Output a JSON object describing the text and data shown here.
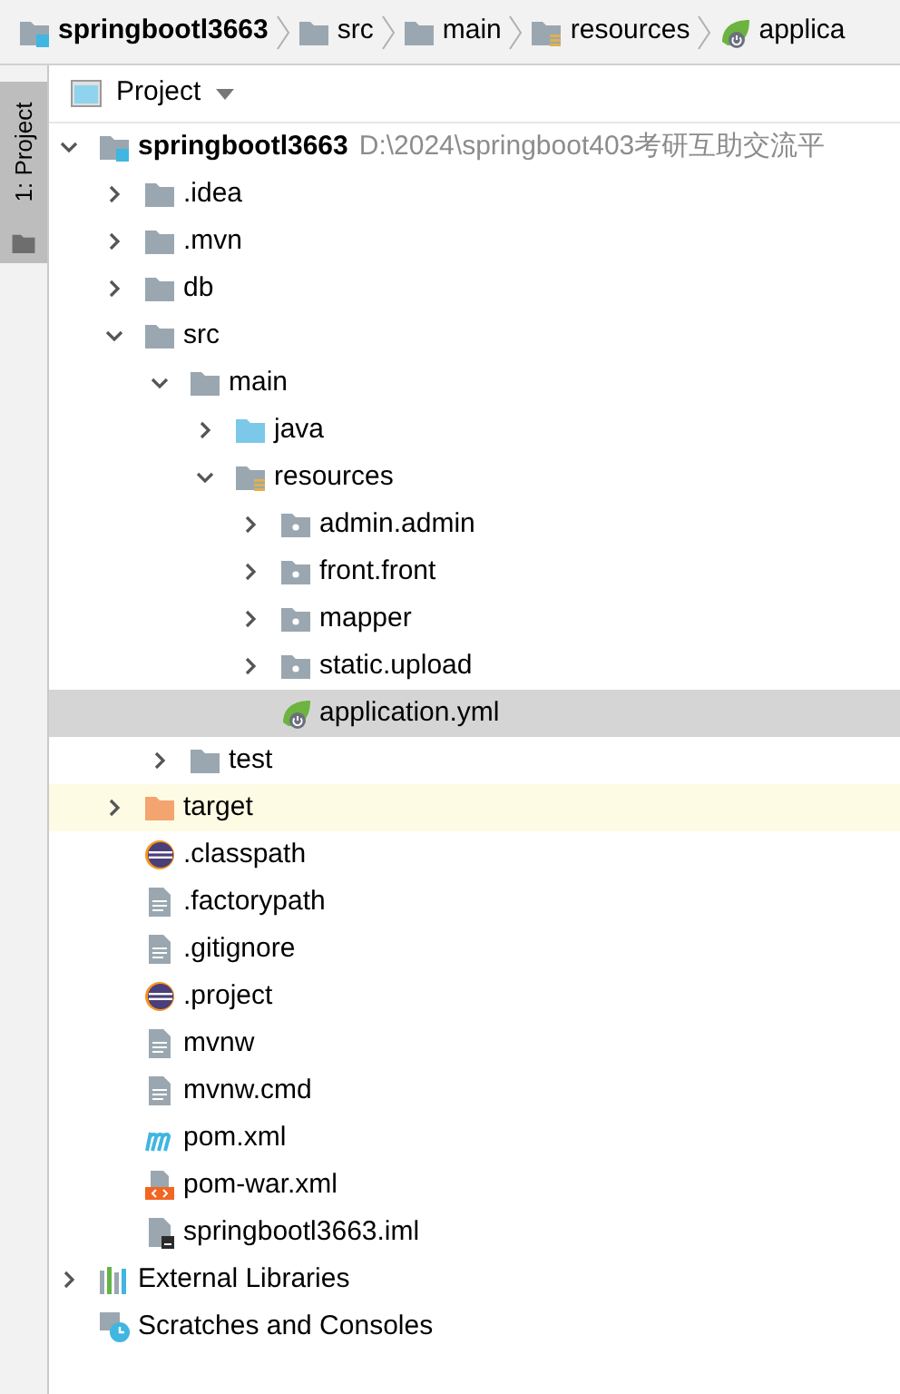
{
  "breadcrumbs": [
    {
      "label": "springbootl3663",
      "kind": "module",
      "bold": true
    },
    {
      "label": "src",
      "kind": "folder",
      "bold": false
    },
    {
      "label": "main",
      "kind": "folder",
      "bold": false
    },
    {
      "label": "resources",
      "kind": "resources",
      "bold": false
    },
    {
      "label": "applica",
      "kind": "spring",
      "bold": false
    }
  ],
  "side_tab": {
    "label": "1: Project",
    "selected": true
  },
  "panel": {
    "title": "Project"
  },
  "tree": [
    {
      "name": "springbootl3663",
      "path": "D:\\2024\\springboot403考研互助交流平",
      "kind": "module",
      "expanded": true,
      "children": [
        {
          "name": ".idea",
          "kind": "folder",
          "expanded": false
        },
        {
          "name": ".mvn",
          "kind": "folder",
          "expanded": false
        },
        {
          "name": "db",
          "kind": "folder",
          "expanded": false
        },
        {
          "name": "src",
          "kind": "folder",
          "expanded": true,
          "children": [
            {
              "name": "main",
              "kind": "folder",
              "expanded": true,
              "children": [
                {
                  "name": "java",
                  "kind": "source",
                  "expanded": false
                },
                {
                  "name": "resources",
                  "kind": "resources",
                  "expanded": true,
                  "children": [
                    {
                      "name": "admin.admin",
                      "kind": "package",
                      "expanded": false
                    },
                    {
                      "name": "front.front",
                      "kind": "package",
                      "expanded": false
                    },
                    {
                      "name": "mapper",
                      "kind": "package",
                      "expanded": false
                    },
                    {
                      "name": "static.upload",
                      "kind": "package",
                      "expanded": false
                    },
                    {
                      "name": "application.yml",
                      "kind": "spring",
                      "selected": true
                    }
                  ]
                }
              ]
            },
            {
              "name": "test",
              "kind": "folder",
              "expanded": false
            }
          ]
        },
        {
          "name": "target",
          "kind": "excluded",
          "expanded": false,
          "highlighted": true
        },
        {
          "name": ".classpath",
          "kind": "eclipse"
        },
        {
          "name": ".factorypath",
          "kind": "text"
        },
        {
          "name": ".gitignore",
          "kind": "text"
        },
        {
          "name": ".project",
          "kind": "eclipse"
        },
        {
          "name": "mvnw",
          "kind": "text"
        },
        {
          "name": "mvnw.cmd",
          "kind": "text"
        },
        {
          "name": "pom.xml",
          "kind": "maven"
        },
        {
          "name": "pom-war.xml",
          "kind": "xml"
        },
        {
          "name": "springbootl3663.iml",
          "kind": "iml"
        }
      ]
    },
    {
      "name": "External Libraries",
      "kind": "libraries",
      "expanded": false
    },
    {
      "name": "Scratches and Consoles",
      "kind": "scratches"
    }
  ]
}
